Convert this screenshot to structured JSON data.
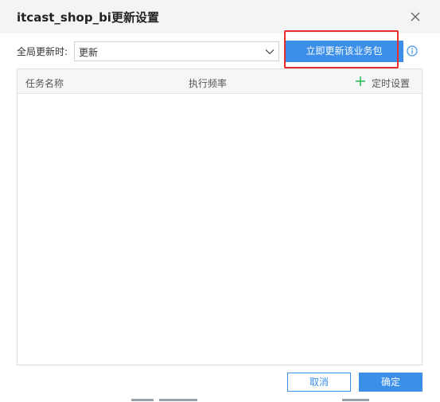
{
  "dialog": {
    "title": "itcast_shop_bi更新设置"
  },
  "toolbar": {
    "global_update_label": "全局更新时:",
    "update_mode_value": "更新",
    "update_now_label": "立即更新该业务包"
  },
  "table": {
    "columns": {
      "task_name": "任务名称",
      "frequency": "执行频率",
      "add_schedule": "定时设置"
    },
    "rows": []
  },
  "footer": {
    "cancel_label": "取消",
    "ok_label": "确定"
  },
  "colors": {
    "accent": "#3b8fe8",
    "highlight": "#e82b2b",
    "add_icon": "#2dbd5a"
  },
  "icons": {
    "close": "close-icon",
    "dropdown": "chevron-down-icon",
    "info": "info-icon",
    "add": "plus-icon"
  }
}
